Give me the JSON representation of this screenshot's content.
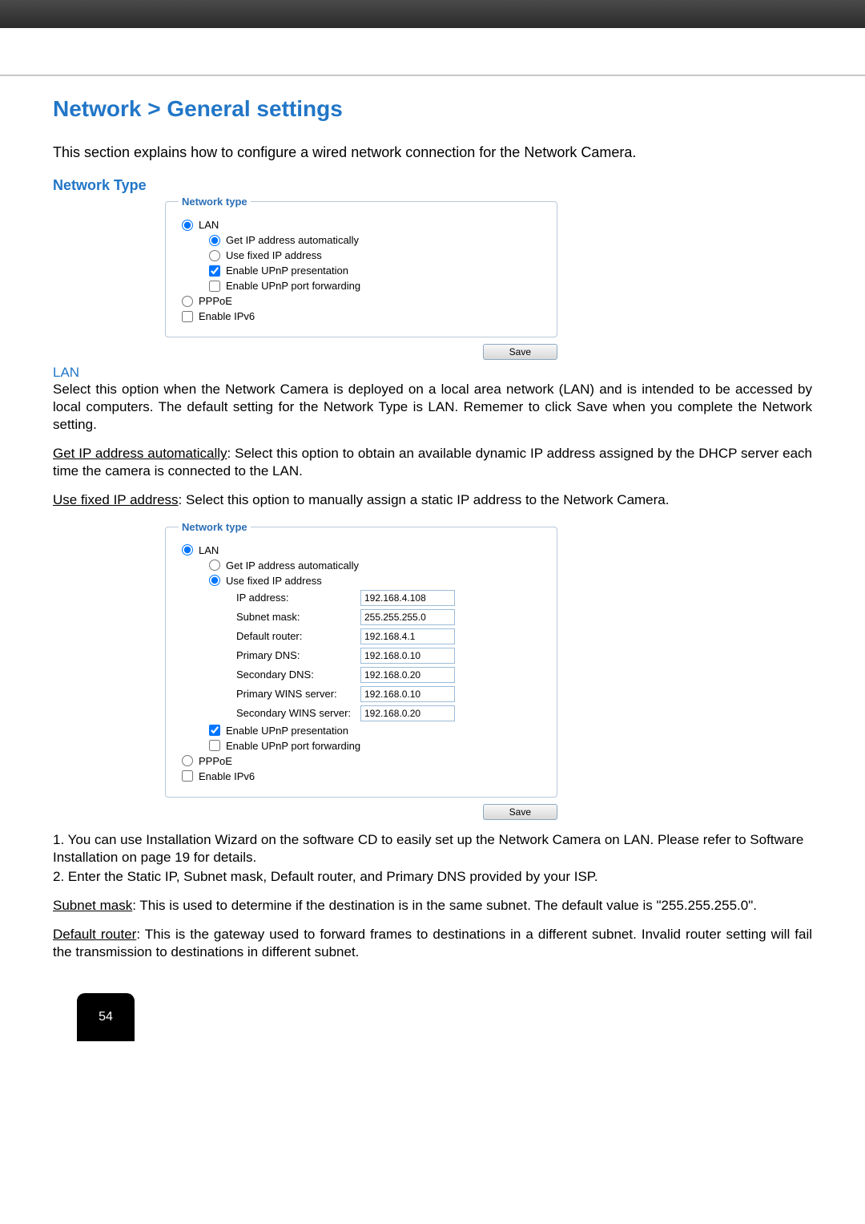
{
  "page_title": "Network > General settings",
  "intro": "This section explains how to configure a wired network connection for the Network Camera.",
  "section_label": "Network Type",
  "lan_heading": "LAN",
  "lan_para": "Select this option when the Network Camera is deployed on a local area network (LAN) and is intended to be accessed by local computers. The default setting for the Network Type is LAN. Rememer to click Save when you complete the Network setting.",
  "auto_ip_term": "Get IP address automatically",
  "auto_ip_desc": ": Select this option to obtain an available dynamic IP address assigned by the DHCP server each time the camera is connected to the LAN.",
  "fixed_ip_term": "Use fixed IP address",
  "fixed_ip_desc": ": Select this option to manually assign a static IP address to the Network Camera.",
  "fieldset1": {
    "legend": "Network type",
    "lan": "LAN",
    "auto_ip": "Get IP address automatically",
    "fixed_ip": "Use fixed IP address",
    "upnp_pres": "Enable UPnP presentation",
    "upnp_port": "Enable UPnP port forwarding",
    "pppoe": "PPPoE",
    "ipv6": "Enable IPv6"
  },
  "save_label": "Save",
  "fieldset2": {
    "legend": "Network type",
    "lan": "LAN",
    "auto_ip": "Get IP address automatically",
    "fixed_ip": "Use fixed IP address",
    "ip_label": "IP address:",
    "ip_val": "192.168.4.108",
    "mask_label": "Subnet mask:",
    "mask_val": "255.255.255.0",
    "router_label": "Default router:",
    "router_val": "192.168.4.1",
    "pdns_label": "Primary DNS:",
    "pdns_val": "192.168.0.10",
    "sdns_label": "Secondary DNS:",
    "sdns_val": "192.168.0.20",
    "pwins_label": "Primary WINS server:",
    "pwins_val": "192.168.0.10",
    "swins_label": "Secondary WINS server:",
    "swins_val": "192.168.0.20",
    "upnp_pres": "Enable UPnP presentation",
    "upnp_port": "Enable UPnP port forwarding",
    "pppoe": "PPPoE",
    "ipv6": "Enable IPv6"
  },
  "list_item1": "1. You can use Installation Wizard on the software CD to easily set up the Network Camera on LAN. Please refer to Software Installation on page 19 for details.",
  "list_item2": "2. Enter the Static IP, Subnet mask, Default router, and Primary DNS provided by your ISP.",
  "subnet_term": "Subnet mask",
  "subnet_desc": ": This is used to determine if the destination is in the same subnet. The default value is \"255.255.255.0\".",
  "router_term": "Default router",
  "router_desc": ": This is the gateway used to forward frames to destinations in a different subnet. Invalid router setting will fail the transmission to destinations in different subnet.",
  "page_number": "54"
}
